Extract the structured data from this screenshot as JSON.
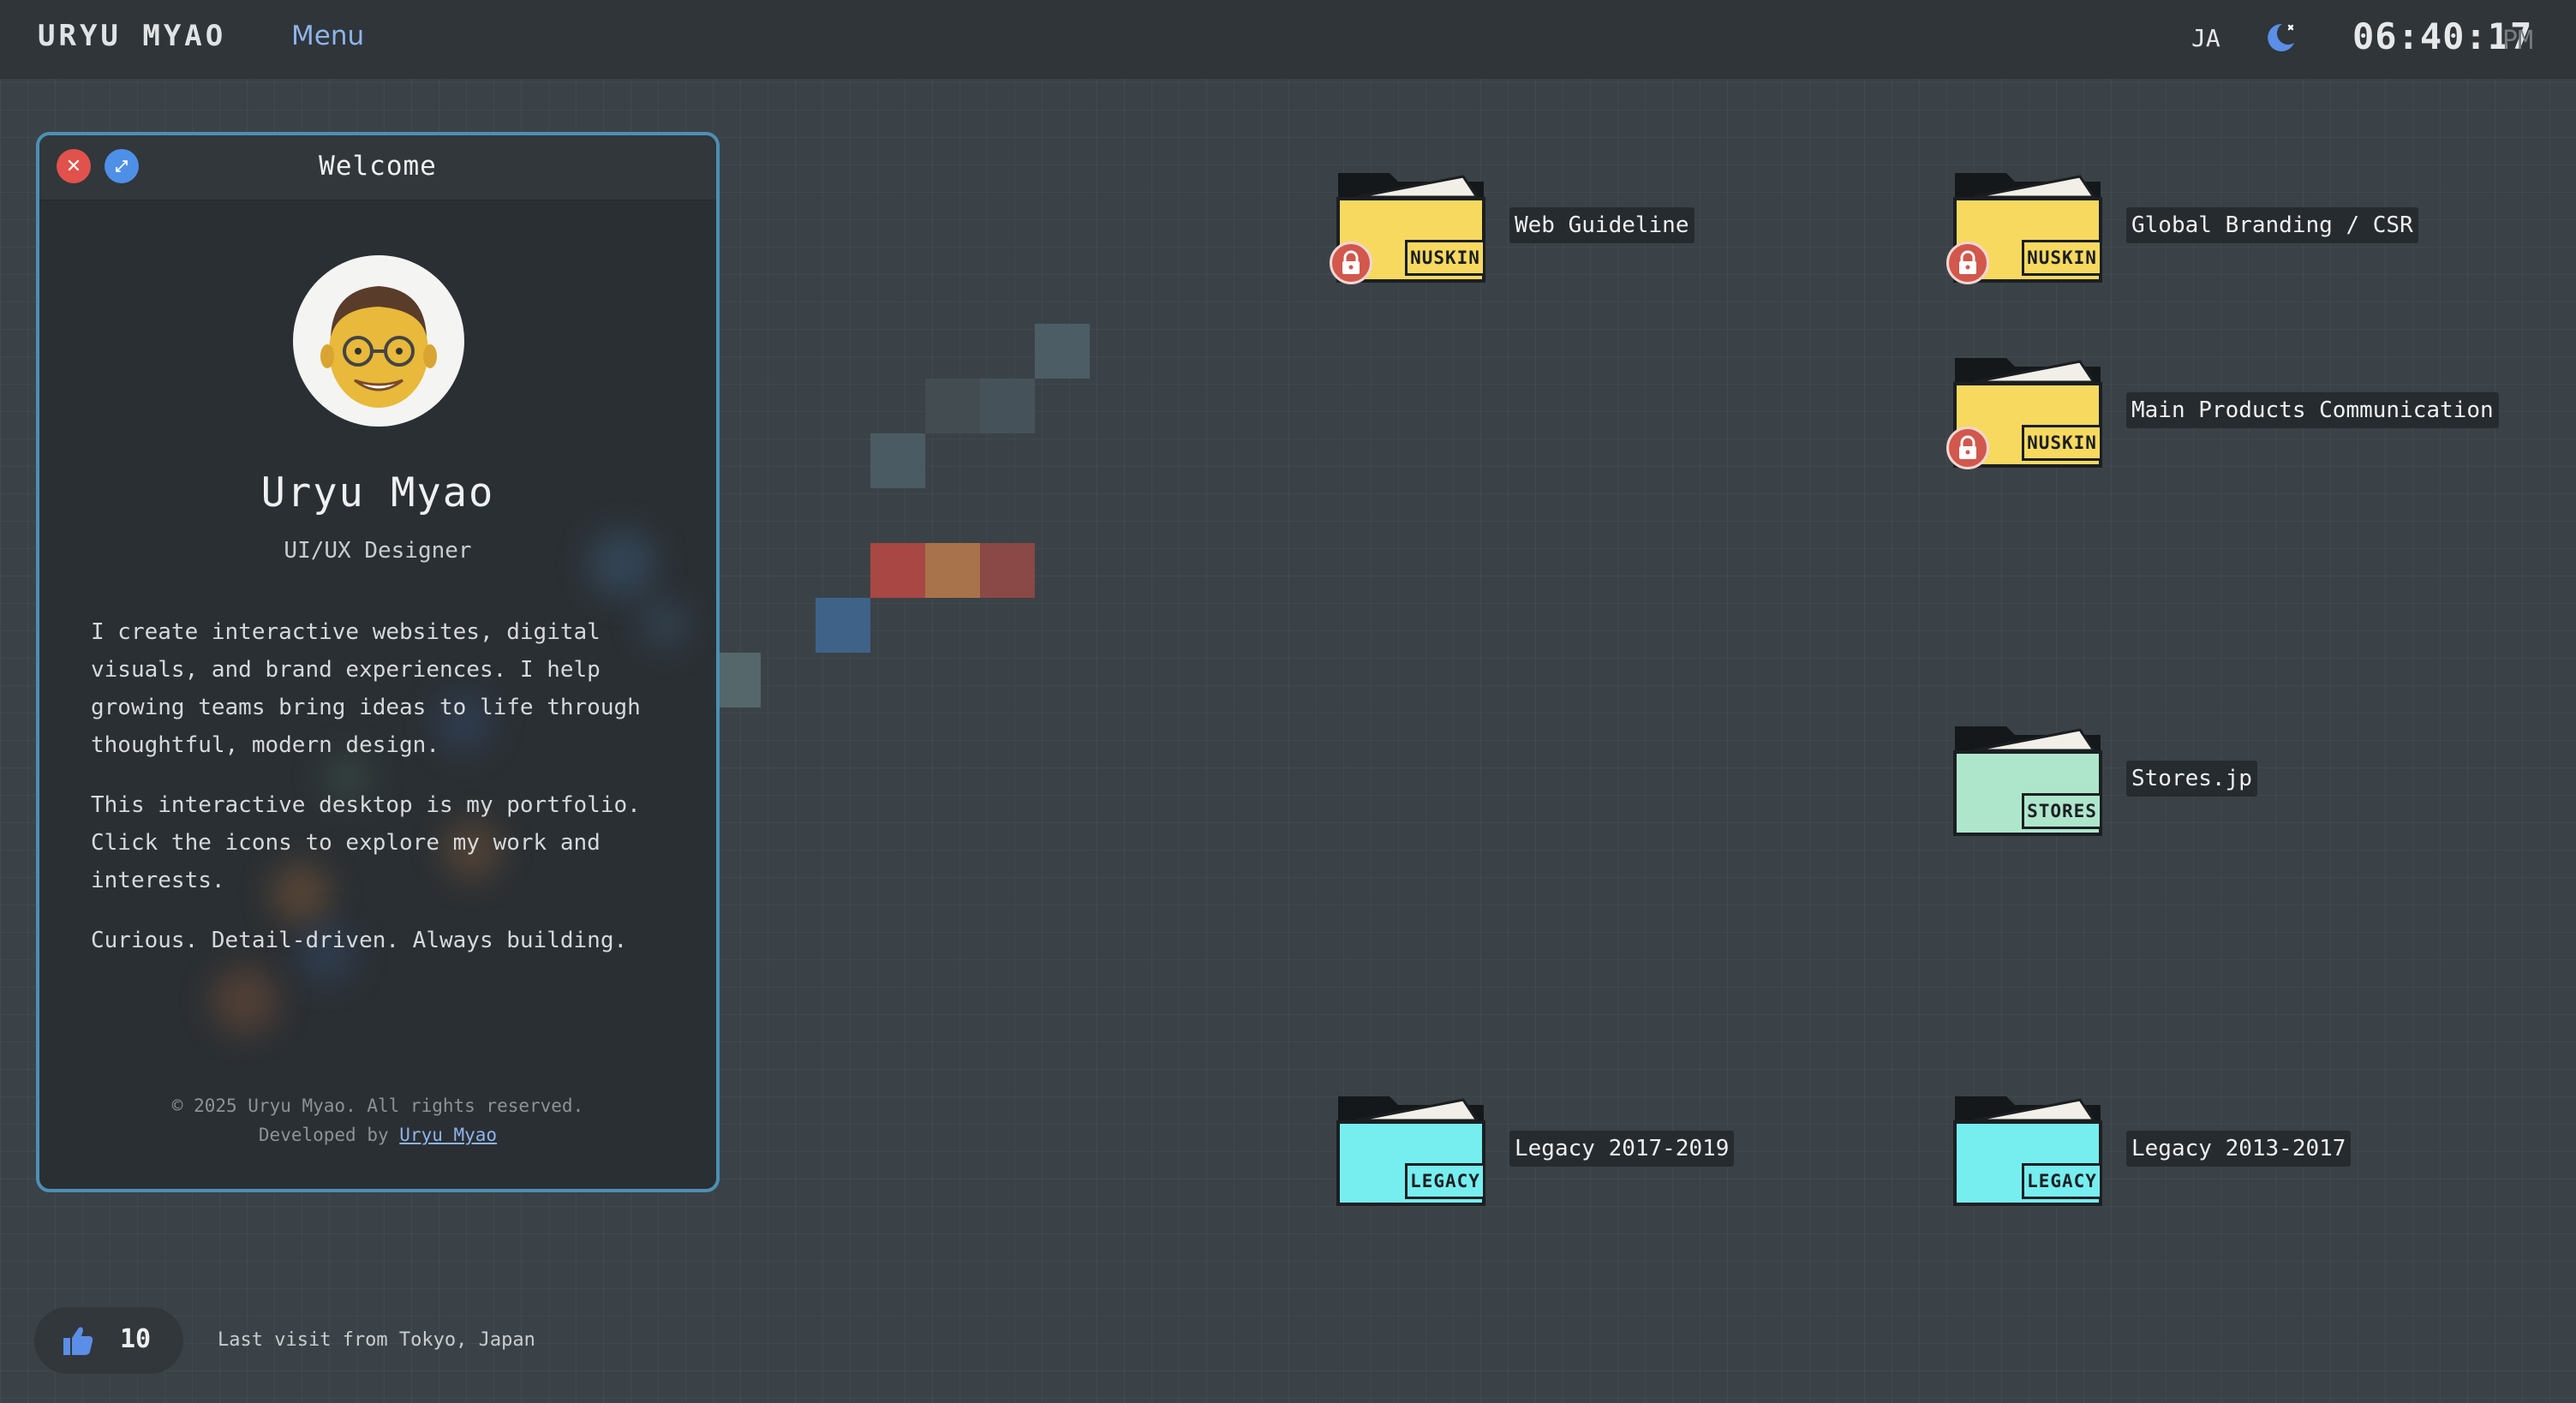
{
  "topbar": {
    "brand": "URYU MYAO",
    "menu_label": "Menu",
    "language": "JA",
    "theme_icon": "moon-icon",
    "time": "06:40:17",
    "ampm": "PM"
  },
  "window": {
    "title": "Welcome",
    "close_icon": "close-icon",
    "expand_icon": "expand-icon",
    "avatar": "memoji-avatar",
    "name": "Uryu Myao",
    "role": "UI/UX Designer",
    "bio": [
      "I create interactive websites, digital visuals, and brand experiences. I help growing teams bring ideas to life through thoughtful, modern design.",
      "This interactive desktop is my portfolio. Click the icons to explore my work and interests.",
      "Curious. Detail-driven. Always building."
    ],
    "footer_copyright": "© 2025 Uryu Myao. All rights reserved.",
    "footer_developed_by": "Developed by",
    "footer_developer": "Uryu Myao"
  },
  "folders": [
    {
      "label": "Web Guideline",
      "tag": "NUSKIN",
      "color": "#f7d960",
      "locked": true
    },
    {
      "label": "Global Branding / CSR",
      "tag": "NUSKIN",
      "color": "#f7d960",
      "locked": true
    },
    {
      "label": "Main Products Communication",
      "tag": "NUSKIN",
      "color": "#f7d960",
      "locked": true
    },
    {
      "label": "Stores.jp",
      "tag": "STORES",
      "color": "#aee6cc",
      "locked": false
    },
    {
      "label": "Legacy 2017-2019",
      "tag": "LEGACY",
      "color": "#76eef0",
      "locked": false
    },
    {
      "label": "Legacy 2013-2017",
      "tag": "LEGACY",
      "color": "#76eef0",
      "locked": false
    }
  ],
  "likes": {
    "icon": "thumbs-up-icon",
    "count": "10"
  },
  "last_visit": "Last visit from Tokyo, Japan",
  "colors": {
    "accent": "#4d8fb4",
    "close": "#e0524b",
    "expand": "#4e8fe8",
    "lock": "#d2574c",
    "link": "#8fb3ea"
  }
}
